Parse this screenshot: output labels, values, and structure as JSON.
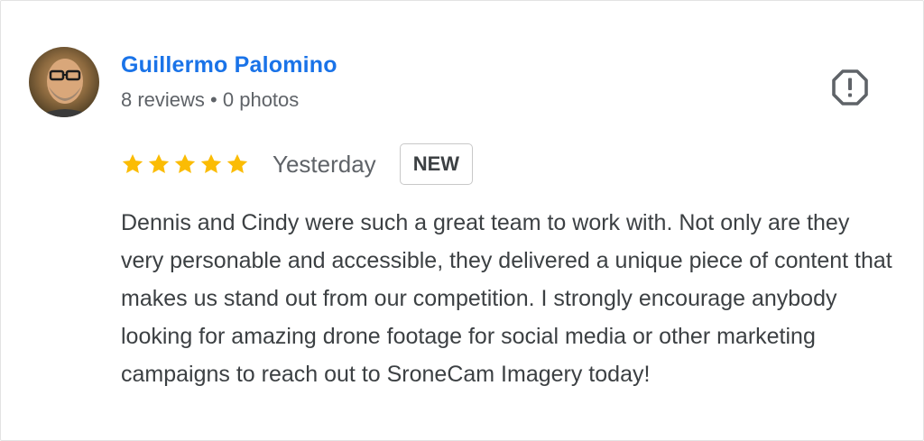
{
  "reviewer": {
    "name": "Guillermo Palomino",
    "reviews_count": "8 reviews",
    "separator": "•",
    "photos_count": "0 photos"
  },
  "review": {
    "rating": 5,
    "rating_max": 5,
    "star_color": "#fbbc04",
    "date": "Yesterday",
    "badge": "NEW",
    "text": "Dennis and Cindy were such a great team to work with. Not only are they very personable and accessible, they delivered a unique piece of content that makes us stand out from our competition. I strongly encourage anybody looking for amazing drone footage for social media or other marketing campaigns to reach out to SroneCam Imagery today!"
  },
  "icons": {
    "report": "report-flag-octagon-exclamation-icon",
    "star": "star-icon"
  },
  "colors": {
    "name_link": "#1a73e8",
    "meta_text": "#5f6368",
    "body_text": "#3c4043"
  }
}
